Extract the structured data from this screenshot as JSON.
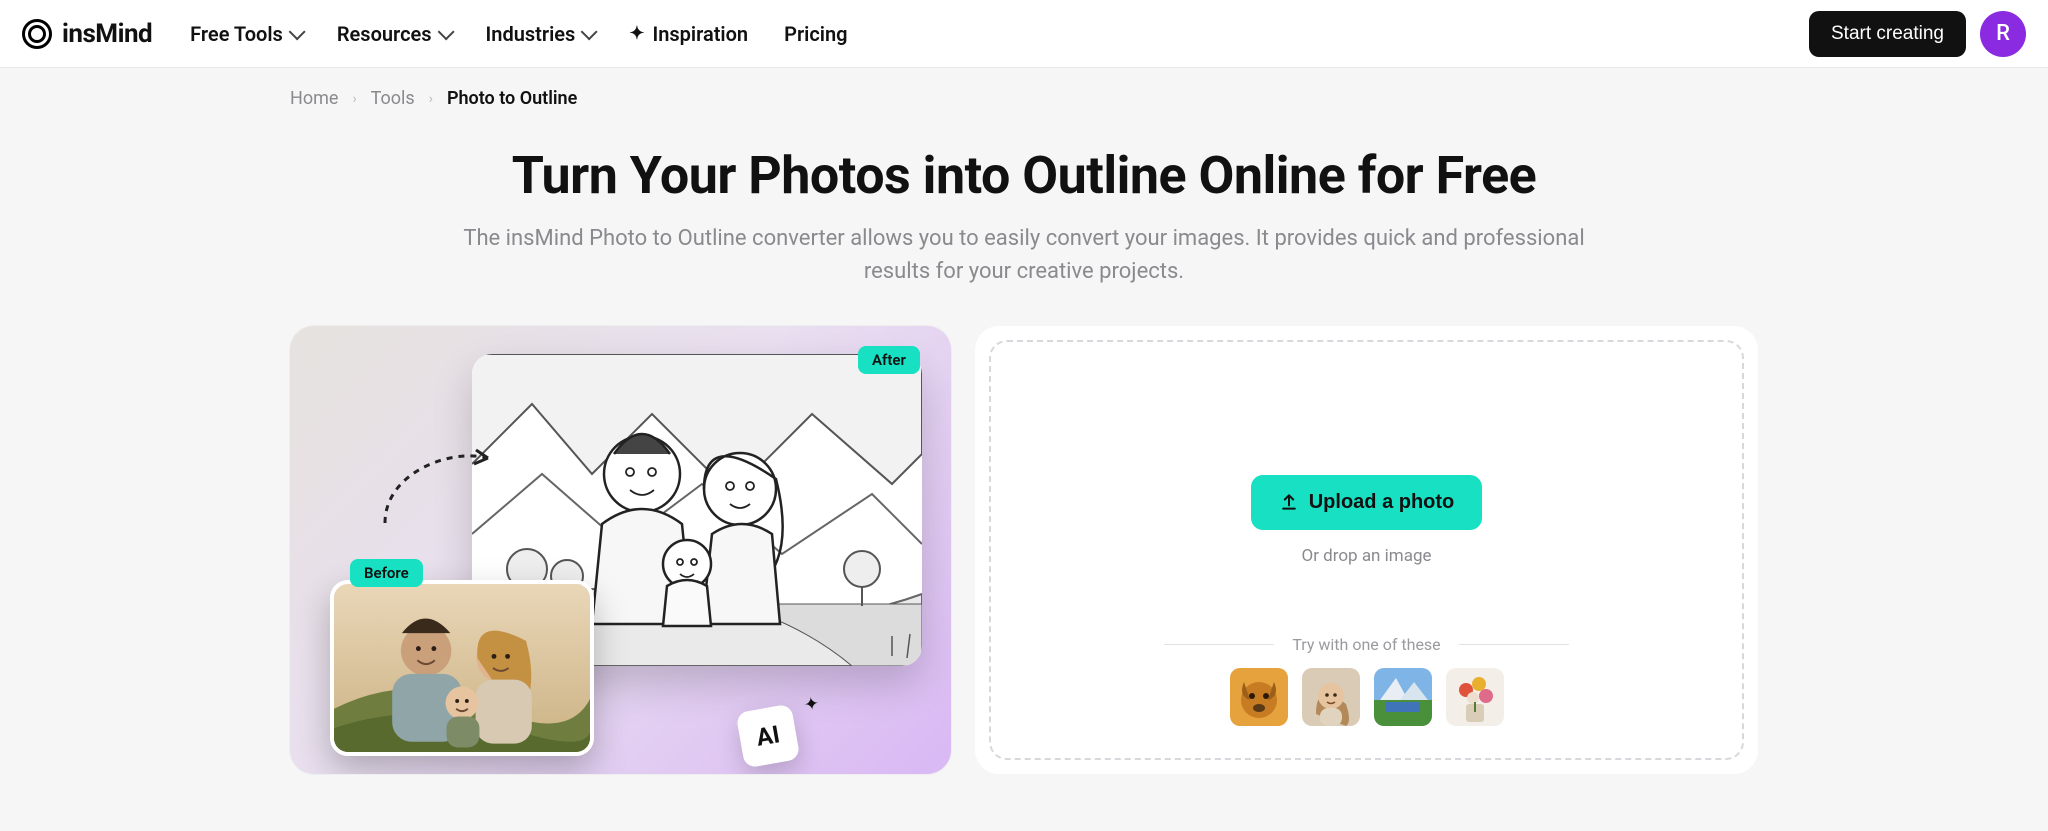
{
  "brand": {
    "name": "insMind"
  },
  "nav": {
    "free_tools": "Free Tools",
    "resources": "Resources",
    "industries": "Industries",
    "inspiration": "Inspiration",
    "pricing": "Pricing"
  },
  "header": {
    "start_creating": "Start creating",
    "avatar_initial": "R"
  },
  "breadcrumb": {
    "home": "Home",
    "tools": "Tools",
    "current": "Photo to Outline"
  },
  "hero": {
    "title": "Turn Your Photos into Outline Online for Free",
    "subtitle": "The insMind Photo to Outline converter allows you to easily convert your images. It provides quick and professional results for your creative projects."
  },
  "preview": {
    "after_badge": "After",
    "before_badge": "Before",
    "ai_chip": "AI"
  },
  "upload": {
    "button": "Upload a photo",
    "hint": "Or drop an image",
    "try_label": "Try with one of these",
    "thumbs": [
      "dog",
      "woman",
      "mountain",
      "flowers"
    ]
  }
}
